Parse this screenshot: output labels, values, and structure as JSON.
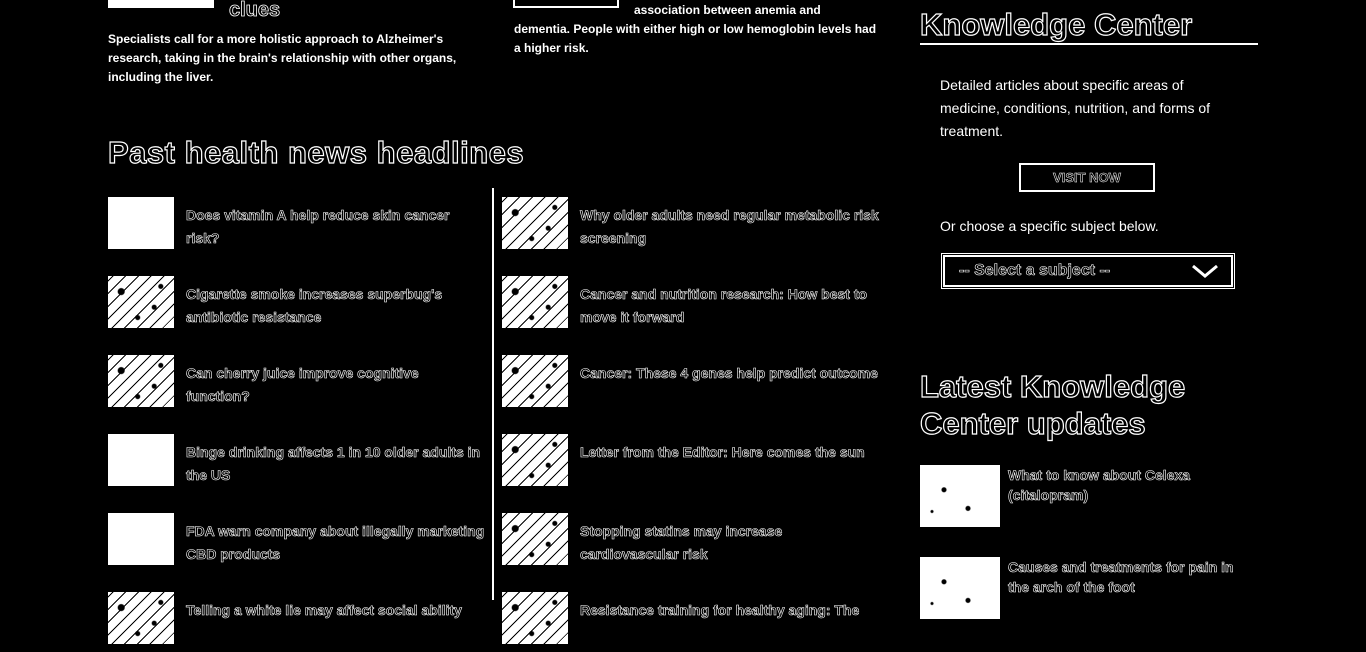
{
  "top_articles": [
    {
      "title": "clues",
      "summary": "Specialists call for a more holistic approach to Alzheimer's research, taking in the brain's relationship with other organs, including the liver."
    },
    {
      "summary": "association between anemia and dementia. People with either high or low hemoglobin levels had a higher risk."
    }
  ],
  "past_news": {
    "heading": "Past health news headlines",
    "left": [
      {
        "title": "Does vitamin A help reduce skin cancer risk?"
      },
      {
        "title": "Cigarette smoke increases superbug's antibiotic resistance"
      },
      {
        "title": "Can cherry juice improve cognitive function?"
      },
      {
        "title": "Binge drinking affects 1 in 10 older adults in the US"
      },
      {
        "title": "FDA warn company about illegally marketing CBD products"
      },
      {
        "title": "Telling a white lie may affect social ability"
      }
    ],
    "right": [
      {
        "title": "Why older adults need regular metabolic risk screening"
      },
      {
        "title": "Cancer and nutrition research: How best to move it forward"
      },
      {
        "title": "Cancer: These 4 genes help predict outcome"
      },
      {
        "title": "Letter from the Editor: Here comes the sun"
      },
      {
        "title": "Stopping statins may increase cardiovascular risk"
      },
      {
        "title": "Resistance training for healthy aging: The"
      }
    ]
  },
  "knowledge_center": {
    "heading": "Knowledge Center",
    "description": "Detailed articles about specific areas of medicine, conditions, nutrition, and forms of treatment.",
    "visit_label": "VISIT NOW",
    "choose_text": "Or choose a specific subject below.",
    "select_value": "-- Select a subject --"
  },
  "latest_updates": {
    "heading_line1": "Latest Knowledge",
    "heading_line2": "Center updates",
    "items": [
      {
        "title": "What to know about Celexa (citalopram)"
      },
      {
        "title": "Causes and treatments for pain in the arch of the foot"
      }
    ]
  }
}
